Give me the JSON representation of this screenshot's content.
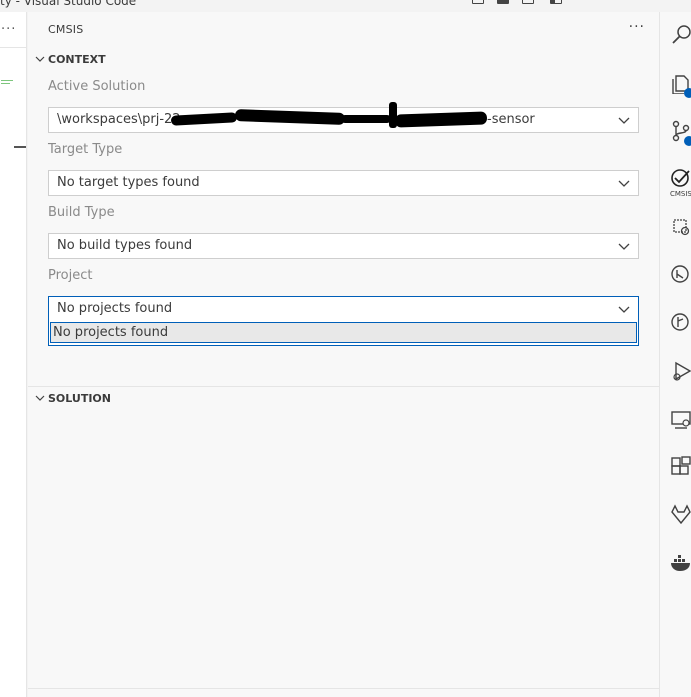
{
  "window": {
    "title": "ty - Visual Studio Code"
  },
  "panel": {
    "title": "CMSIS",
    "more_label": "···",
    "context": {
      "header": "CONTEXT",
      "active_solution": {
        "label": "Active Solution",
        "value": "\\workspaces\\prj-22",
        "value_suffix": "-sensor"
      },
      "target_type": {
        "label": "Target Type",
        "value": "No target types found"
      },
      "build_type": {
        "label": "Build Type",
        "value": "No build types found"
      },
      "project": {
        "label": "Project",
        "value": "No projects found",
        "options": [
          "No projects found"
        ]
      }
    },
    "solution": {
      "header": "SOLUTION"
    }
  },
  "left_editor": {
    "more_label": "···"
  },
  "activity_bar": {
    "cmsis_label": "CMSIS"
  },
  "colors": {
    "accent": "#005fb8",
    "selected_option": "#e8e8e8"
  }
}
